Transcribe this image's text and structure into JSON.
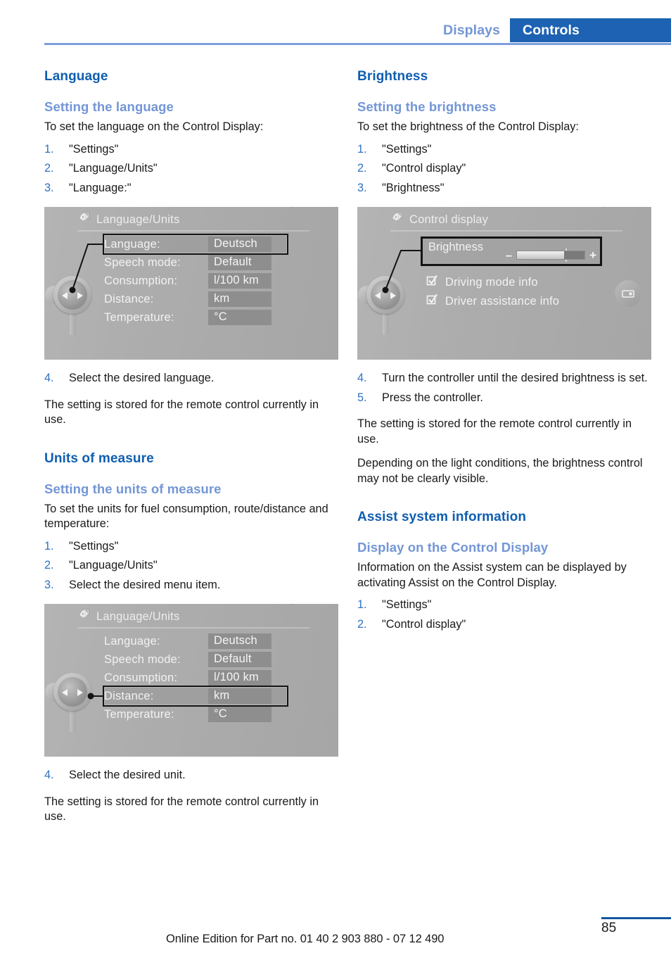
{
  "header": {
    "tab_inactive": "Displays",
    "tab_active": "Controls",
    "accent_blue": "#0f5eb0",
    "light_blue": "#7396d6",
    "tab_active_bg": "#1d62b3"
  },
  "left_column": {
    "section1_title": "Language",
    "sub1_title": "Setting the language",
    "intro1": "To set the language on the Control Display:",
    "steps1": [
      {
        "num": "1.",
        "text": "\"Settings\""
      },
      {
        "num": "2.",
        "text": "\"Language/Units\""
      },
      {
        "num": "3.",
        "text": "\"Language:\""
      }
    ],
    "step4": {
      "num": "4.",
      "text": "Select the desired language."
    },
    "note1": "The setting is stored for the remote control currently in use.",
    "section2_title": "Units of measure",
    "sub2_title": "Setting the units of measure",
    "intro2": "To set the units for fuel consumption, route/distance and temperature:",
    "steps2": [
      {
        "num": "1.",
        "text": "\"Settings\""
      },
      {
        "num": "2.",
        "text": "\"Language/Units\""
      },
      {
        "num": "3.",
        "text": "Select the desired menu item."
      }
    ],
    "step4b": {
      "num": "4.",
      "text": "Select the desired unit."
    },
    "note2": "The setting is stored for the remote control currently in use."
  },
  "right_column": {
    "section1_title": "Brightness",
    "sub1_title": "Setting the brightness",
    "intro1": "To set the brightness of the Control Display:",
    "steps1": [
      {
        "num": "1.",
        "text": "\"Settings\""
      },
      {
        "num": "2.",
        "text": "\"Control display\""
      },
      {
        "num": "3.",
        "text": "\"Brightness\""
      }
    ],
    "steps2": [
      {
        "num": "4.",
        "text": "Turn the controller until the desired brightness is set."
      },
      {
        "num": "5.",
        "text": "Press the controller."
      }
    ],
    "note1": "The setting is stored for the remote control currently in use.",
    "note2": "Depending on the light conditions, the brightness control may not be clearly visible.",
    "section2_title": "Assist system information",
    "sub2_title": "Display on the Control Display",
    "intro2": "Information on the Assist system can be displayed by activating Assist on the Control Display.",
    "steps3": [
      {
        "num": "1.",
        "text": "\"Settings\""
      },
      {
        "num": "2.",
        "text": "\"Control display\""
      }
    ]
  },
  "control_display_1": {
    "title": "Language/Units",
    "rows": [
      {
        "label": "Language:",
        "value": "Deutsch",
        "selected": true
      },
      {
        "label": "Speech mode:",
        "value": "Default",
        "selected": false
      },
      {
        "label": "Consumption:",
        "value": "l/100 km",
        "selected": false
      },
      {
        "label": "Distance:",
        "value": "km",
        "selected": false
      },
      {
        "label": "Temperature:",
        "value": "°C",
        "selected": false
      }
    ]
  },
  "control_display_2": {
    "title": "Control display",
    "brightness_label": "Brightness",
    "minus": "–",
    "plus": "+",
    "slider_fill_percent": 70,
    "checkboxes": [
      {
        "label": "Driving mode info",
        "checked": true
      },
      {
        "label": "Driver assistance info",
        "checked": true
      }
    ]
  },
  "control_display_3": {
    "title": "Language/Units",
    "rows": [
      {
        "label": "Language:",
        "value": "Deutsch",
        "selected": false
      },
      {
        "label": "Speech mode:",
        "value": "Default",
        "selected": false
      },
      {
        "label": "Consumption:",
        "value": "l/100 km",
        "selected": false
      },
      {
        "label": "Distance:",
        "value": "km",
        "selected": true
      },
      {
        "label": "Temperature:",
        "value": "°C",
        "selected": false
      }
    ]
  },
  "footer": {
    "edition": "Online Edition for Part no. 01 40 2 903 880 - 07 12 490",
    "page_number": "85"
  }
}
